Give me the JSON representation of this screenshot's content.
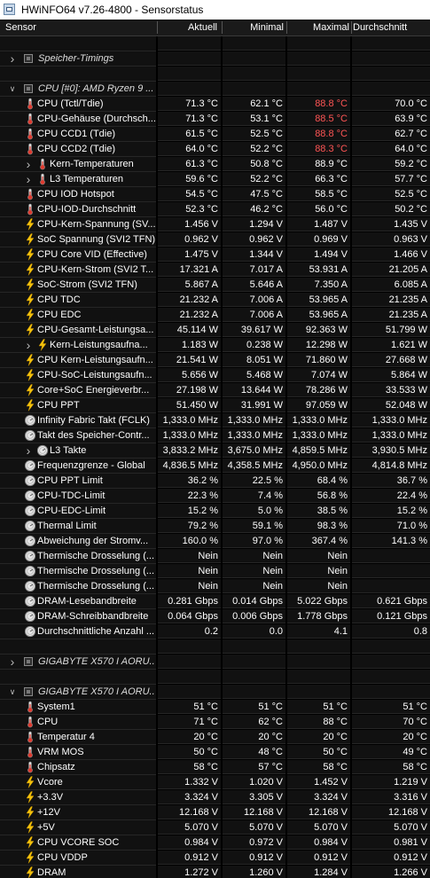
{
  "window": {
    "title": "HWiNFO64 v7.26-4800 - Sensorstatus"
  },
  "header": {
    "sensor": "Sensor",
    "current": "Aktuell",
    "min": "Minimal",
    "max": "Maximal",
    "avg": "Durchschnitt"
  },
  "rows": [
    {
      "type": "blank"
    },
    {
      "type": "group",
      "name": "Speicher-Timings",
      "icon": "chip-icon",
      "expander": "collapsed"
    },
    {
      "type": "blank"
    },
    {
      "type": "group",
      "name": "CPU [#0]: AMD Ryzen 9 ...",
      "icon": "chip-icon",
      "expander": "expanded"
    },
    {
      "type": "item",
      "icon": "thermometer-icon",
      "name": "CPU (Tctl/Tdie)",
      "v": [
        "71.3 °C",
        "62.1 °C",
        "88.8 °C",
        "70.0 °C"
      ],
      "red_max": true
    },
    {
      "type": "item",
      "icon": "thermometer-icon",
      "name": "CPU-Gehäuse (Durchsch...",
      "v": [
        "71.3 °C",
        "53.1 °C",
        "88.5 °C",
        "63.9 °C"
      ],
      "red_max": true
    },
    {
      "type": "item",
      "icon": "thermometer-icon",
      "name": "CPU CCD1 (Tdie)",
      "v": [
        "61.5 °C",
        "52.5 °C",
        "88.8 °C",
        "62.7 °C"
      ],
      "red_max": true
    },
    {
      "type": "item",
      "icon": "thermometer-icon",
      "name": "CPU CCD2 (Tdie)",
      "v": [
        "64.0 °C",
        "52.2 °C",
        "88.3 °C",
        "64.0 °C"
      ],
      "red_max": true
    },
    {
      "type": "sub",
      "icon": "thermometer-icon",
      "name": "Kern-Temperaturen",
      "v": [
        "61.3 °C",
        "50.8 °C",
        "88.9 °C",
        "59.2 °C"
      ]
    },
    {
      "type": "sub",
      "icon": "thermometer-icon",
      "name": "L3 Temperaturen",
      "v": [
        "59.6 °C",
        "52.2 °C",
        "66.3 °C",
        "57.7 °C"
      ]
    },
    {
      "type": "item",
      "icon": "thermometer-icon",
      "name": "CPU IOD Hotspot",
      "v": [
        "54.5 °C",
        "47.5 °C",
        "58.5 °C",
        "52.5 °C"
      ]
    },
    {
      "type": "item",
      "icon": "thermometer-icon",
      "name": "CPU-IOD-Durchschnitt",
      "v": [
        "52.3 °C",
        "46.2 °C",
        "56.0 °C",
        "50.2 °C"
      ]
    },
    {
      "type": "item",
      "icon": "bolt-icon",
      "name": "CPU-Kern-Spannung (SV...",
      "v": [
        "1.456 V",
        "1.294 V",
        "1.487 V",
        "1.435 V"
      ]
    },
    {
      "type": "item",
      "icon": "bolt-icon",
      "name": "SoC Spannung (SVI2 TFN)",
      "v": [
        "0.962 V",
        "0.962 V",
        "0.969 V",
        "0.963 V"
      ]
    },
    {
      "type": "item",
      "icon": "bolt-icon",
      "name": "CPU Core VID (Effective)",
      "v": [
        "1.475 V",
        "1.344 V",
        "1.494 V",
        "1.466 V"
      ]
    },
    {
      "type": "item",
      "icon": "bolt-icon",
      "name": "CPU-Kern-Strom (SVI2 T...",
      "v": [
        "17.321 A",
        "7.017 A",
        "53.931 A",
        "21.205 A"
      ]
    },
    {
      "type": "item",
      "icon": "bolt-icon",
      "name": "SoC-Strom (SVI2 TFN)",
      "v": [
        "5.867 A",
        "5.646 A",
        "7.350 A",
        "6.085 A"
      ]
    },
    {
      "type": "item",
      "icon": "bolt-icon",
      "name": "CPU TDC",
      "v": [
        "21.232 A",
        "7.006 A",
        "53.965 A",
        "21.235 A"
      ]
    },
    {
      "type": "item",
      "icon": "bolt-icon",
      "name": "CPU EDC",
      "v": [
        "21.232 A",
        "7.006 A",
        "53.965 A",
        "21.235 A"
      ]
    },
    {
      "type": "item",
      "icon": "bolt-icon",
      "name": "CPU-Gesamt-Leistungsa...",
      "v": [
        "45.114 W",
        "39.617 W",
        "92.363 W",
        "51.799 W"
      ]
    },
    {
      "type": "sub",
      "icon": "bolt-icon",
      "name": "Kern-Leistungsaufna...",
      "v": [
        "1.183 W",
        "0.238 W",
        "12.298 W",
        "1.621 W"
      ]
    },
    {
      "type": "item",
      "icon": "bolt-icon",
      "name": "CPU Kern-Leistungsaufn...",
      "v": [
        "21.541 W",
        "8.051 W",
        "71.860 W",
        "27.668 W"
      ]
    },
    {
      "type": "item",
      "icon": "bolt-icon",
      "name": "CPU-SoC-Leistungsaufn...",
      "v": [
        "5.656 W",
        "5.468 W",
        "7.074 W",
        "5.864 W"
      ]
    },
    {
      "type": "item",
      "icon": "bolt-icon",
      "name": "Core+SoC Energieverbr...",
      "v": [
        "27.198 W",
        "13.644 W",
        "78.286 W",
        "33.533 W"
      ]
    },
    {
      "type": "item",
      "icon": "bolt-icon",
      "name": "CPU PPT",
      "v": [
        "51.450 W",
        "31.991 W",
        "97.059 W",
        "52.048 W"
      ]
    },
    {
      "type": "item",
      "icon": "gauge-icon",
      "name": "Infinity Fabric Takt (FCLK)",
      "v": [
        "1,333.0 MHz",
        "1,333.0 MHz",
        "1,333.0 MHz",
        "1,333.0 MHz"
      ]
    },
    {
      "type": "item",
      "icon": "gauge-icon",
      "name": "Takt des Speicher-Contr...",
      "v": [
        "1,333.0 MHz",
        "1,333.0 MHz",
        "1,333.0 MHz",
        "1,333.0 MHz"
      ]
    },
    {
      "type": "sub",
      "icon": "gauge-icon",
      "name": "L3 Takte",
      "v": [
        "3,833.2 MHz",
        "3,675.0 MHz",
        "4,859.5 MHz",
        "3,930.5 MHz"
      ]
    },
    {
      "type": "item",
      "icon": "gauge-icon",
      "name": "Frequenzgrenze - Global",
      "v": [
        "4,836.5 MHz",
        "4,358.5 MHz",
        "4,950.0 MHz",
        "4,814.8 MHz"
      ]
    },
    {
      "type": "item",
      "icon": "gauge-icon",
      "name": "CPU PPT Limit",
      "v": [
        "36.2 %",
        "22.5 %",
        "68.4 %",
        "36.7 %"
      ]
    },
    {
      "type": "item",
      "icon": "gauge-icon",
      "name": "CPU-TDC-Limit",
      "v": [
        "22.3 %",
        "7.4 %",
        "56.8 %",
        "22.4 %"
      ]
    },
    {
      "type": "item",
      "icon": "gauge-icon",
      "name": "CPU-EDC-Limit",
      "v": [
        "15.2 %",
        "5.0 %",
        "38.5 %",
        "15.2 %"
      ]
    },
    {
      "type": "item",
      "icon": "gauge-icon",
      "name": "Thermal Limit",
      "v": [
        "79.2 %",
        "59.1 %",
        "98.3 %",
        "71.0 %"
      ]
    },
    {
      "type": "item",
      "icon": "gauge-icon",
      "name": "Abweichung der Stromv...",
      "v": [
        "160.0 %",
        "97.0 %",
        "367.4 %",
        "141.3 %"
      ]
    },
    {
      "type": "item",
      "icon": "gauge-icon",
      "name": "Thermische Drosselung (...",
      "v": [
        "Nein",
        "Nein",
        "Nein",
        ""
      ]
    },
    {
      "type": "item",
      "icon": "gauge-icon",
      "name": "Thermische Drosselung (...",
      "v": [
        "Nein",
        "Nein",
        "Nein",
        ""
      ]
    },
    {
      "type": "item",
      "icon": "gauge-icon",
      "name": "Thermische Drosselung (...",
      "v": [
        "Nein",
        "Nein",
        "Nein",
        ""
      ]
    },
    {
      "type": "item",
      "icon": "gauge-icon",
      "name": "DRAM-Lesebandbreite",
      "v": [
        "0.281 Gbps",
        "0.014 Gbps",
        "5.022 Gbps",
        "0.621 Gbps"
      ]
    },
    {
      "type": "item",
      "icon": "gauge-icon",
      "name": "DRAM-Schreibbandbreite",
      "v": [
        "0.064 Gbps",
        "0.006 Gbps",
        "1.778 Gbps",
        "0.121 Gbps"
      ]
    },
    {
      "type": "item",
      "icon": "gauge-icon",
      "name": "Durchschnittliche Anzahl ...",
      "v": [
        "0.2",
        "0.0",
        "4.1",
        "0.8"
      ]
    },
    {
      "type": "blank"
    },
    {
      "type": "group",
      "name": "GIGABYTE X570 I AORU...",
      "icon": "chip-icon",
      "expander": "collapsed"
    },
    {
      "type": "blank"
    },
    {
      "type": "group",
      "name": "GIGABYTE X570 I AORU...",
      "icon": "chip-icon",
      "expander": "expanded"
    },
    {
      "type": "item",
      "icon": "thermometer-icon",
      "name": "System1",
      "v": [
        "51 °C",
        "51 °C",
        "51 °C",
        "51 °C"
      ]
    },
    {
      "type": "item",
      "icon": "thermometer-icon",
      "name": "CPU",
      "v": [
        "71 °C",
        "62 °C",
        "88 °C",
        "70 °C"
      ]
    },
    {
      "type": "item",
      "icon": "thermometer-icon",
      "name": "Temperatur 4",
      "v": [
        "20 °C",
        "20 °C",
        "20 °C",
        "20 °C"
      ]
    },
    {
      "type": "item",
      "icon": "thermometer-icon",
      "name": "VRM MOS",
      "v": [
        "50 °C",
        "48 °C",
        "50 °C",
        "49 °C"
      ]
    },
    {
      "type": "item",
      "icon": "thermometer-icon",
      "name": "Chipsatz",
      "v": [
        "58 °C",
        "57 °C",
        "58 °C",
        "58 °C"
      ]
    },
    {
      "type": "item",
      "icon": "bolt-icon",
      "name": "Vcore",
      "v": [
        "1.332 V",
        "1.020 V",
        "1.452 V",
        "1.219 V"
      ]
    },
    {
      "type": "item",
      "icon": "bolt-icon",
      "name": "+3.3V",
      "v": [
        "3.324 V",
        "3.305 V",
        "3.324 V",
        "3.316 V"
      ]
    },
    {
      "type": "item",
      "icon": "bolt-icon",
      "name": "+12V",
      "v": [
        "12.168 V",
        "12.168 V",
        "12.168 V",
        "12.168 V"
      ]
    },
    {
      "type": "item",
      "icon": "bolt-icon",
      "name": "+5V",
      "v": [
        "5.070 V",
        "5.070 V",
        "5.070 V",
        "5.070 V"
      ]
    },
    {
      "type": "item",
      "icon": "bolt-icon",
      "name": "CPU VCORE SOC",
      "v": [
        "0.984 V",
        "0.972 V",
        "0.984 V",
        "0.981 V"
      ]
    },
    {
      "type": "item",
      "icon": "bolt-icon",
      "name": "CPU VDDP",
      "v": [
        "0.912 V",
        "0.912 V",
        "0.912 V",
        "0.912 V"
      ]
    },
    {
      "type": "item",
      "icon": "bolt-icon",
      "name": "DRAM",
      "v": [
        "1.272 V",
        "1.260 V",
        "1.284 V",
        "1.266 V"
      ]
    }
  ]
}
